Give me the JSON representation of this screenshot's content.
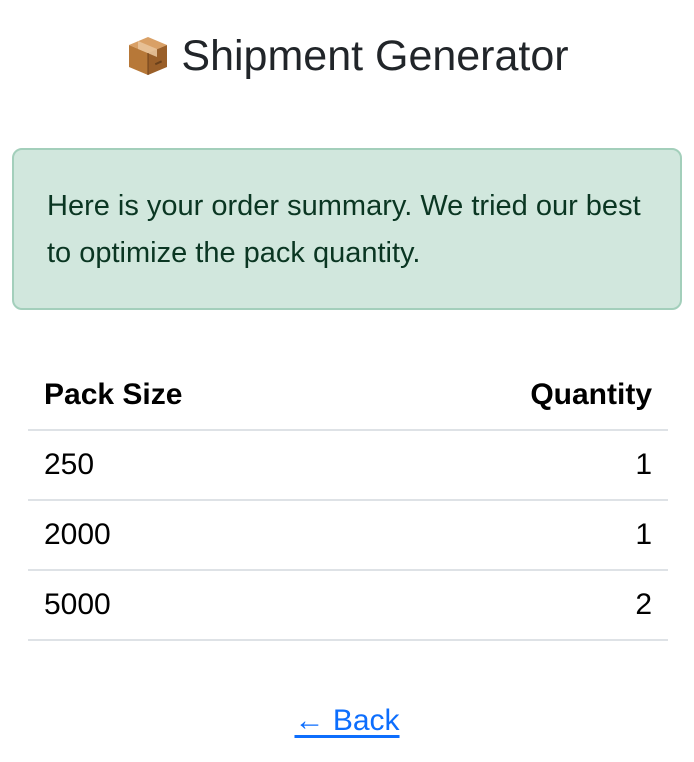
{
  "header": {
    "icon": "package-box-icon",
    "title": "Shipment Generator"
  },
  "alert": {
    "message": "Here is your order summary. We tried our best to optimize the pack quantity.",
    "color": "#d1e7dd"
  },
  "table": {
    "columns": {
      "pack_size": "Pack Size",
      "quantity": "Quantity"
    },
    "rows": [
      {
        "pack_size": "250",
        "quantity": "1"
      },
      {
        "pack_size": "2000",
        "quantity": "1"
      },
      {
        "pack_size": "5000",
        "quantity": "2"
      }
    ]
  },
  "back_link": {
    "label": "← Back",
    "color": "#0d6efd"
  }
}
